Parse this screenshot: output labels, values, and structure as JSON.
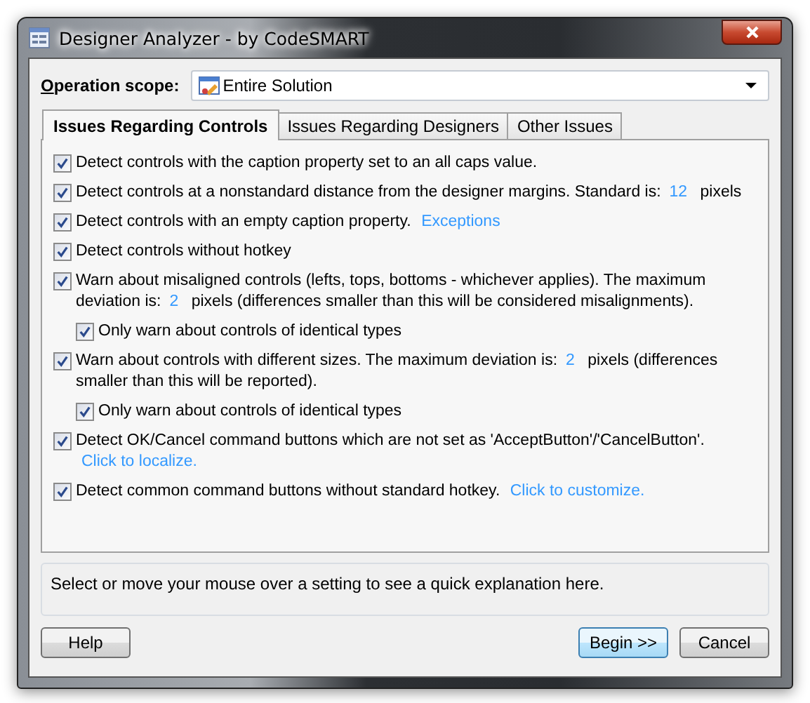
{
  "window": {
    "title": "Designer Analyzer - by CodeSMART"
  },
  "scope": {
    "label": "Operation scope:",
    "value": "Entire Solution"
  },
  "tabs": [
    {
      "label": "Issues Regarding Controls",
      "selected": true
    },
    {
      "label": "Issues Regarding Designers",
      "selected": false
    },
    {
      "label": "Other Issues",
      "selected": false
    }
  ],
  "options": [
    {
      "checked": true,
      "parts": [
        {
          "kind": "text",
          "text": "Detect controls with the caption property set to an all caps value."
        }
      ]
    },
    {
      "checked": true,
      "parts": [
        {
          "kind": "text",
          "text": "Detect controls at a nonstandard distance from the designer margins. Standard is:"
        },
        {
          "kind": "value",
          "text": "12"
        },
        {
          "kind": "text",
          "text": "pixels"
        }
      ]
    },
    {
      "checked": true,
      "parts": [
        {
          "kind": "text",
          "text": "Detect controls with an empty caption property."
        },
        {
          "kind": "link",
          "text": "Exceptions"
        }
      ]
    },
    {
      "checked": true,
      "parts": [
        {
          "kind": "text",
          "text": "Detect controls without hotkey"
        }
      ]
    },
    {
      "checked": true,
      "parts": [
        {
          "kind": "text",
          "text": "Warn about misaligned controls (lefts, tops, bottoms - whichever applies). The maximum deviation is:"
        },
        {
          "kind": "value",
          "text": "2"
        },
        {
          "kind": "text",
          "text": "pixels (differences smaller than this will be considered misalignments)."
        }
      ],
      "children": [
        {
          "checked": true,
          "parts": [
            {
              "kind": "text",
              "text": "Only warn about controls of identical types"
            }
          ]
        }
      ]
    },
    {
      "checked": true,
      "parts": [
        {
          "kind": "text",
          "text": "Warn about controls with different sizes. The maximum deviation is:"
        },
        {
          "kind": "value",
          "text": "2"
        },
        {
          "kind": "text",
          "text": "pixels (differences smaller than this will be reported)."
        }
      ],
      "children": [
        {
          "checked": true,
          "parts": [
            {
              "kind": "text",
              "text": "Only warn about controls of identical types"
            }
          ]
        }
      ]
    },
    {
      "checked": true,
      "parts": [
        {
          "kind": "text",
          "text": "Detect OK/Cancel command buttons which are not set as 'AcceptButton'/'CancelButton'."
        },
        {
          "kind": "link-line",
          "text": "Click to localize."
        }
      ]
    },
    {
      "checked": true,
      "parts": [
        {
          "kind": "text",
          "text": "Detect common command buttons without standard hotkey."
        },
        {
          "kind": "link",
          "text": "Click to customize."
        }
      ]
    }
  ],
  "explanation": "Select or move your mouse over a setting to see a quick explanation here.",
  "buttons": [
    {
      "label": "Help",
      "kind": "normal"
    },
    {
      "label": "Begin >>",
      "kind": "default"
    },
    {
      "label": "Cancel",
      "kind": "normal"
    }
  ]
}
